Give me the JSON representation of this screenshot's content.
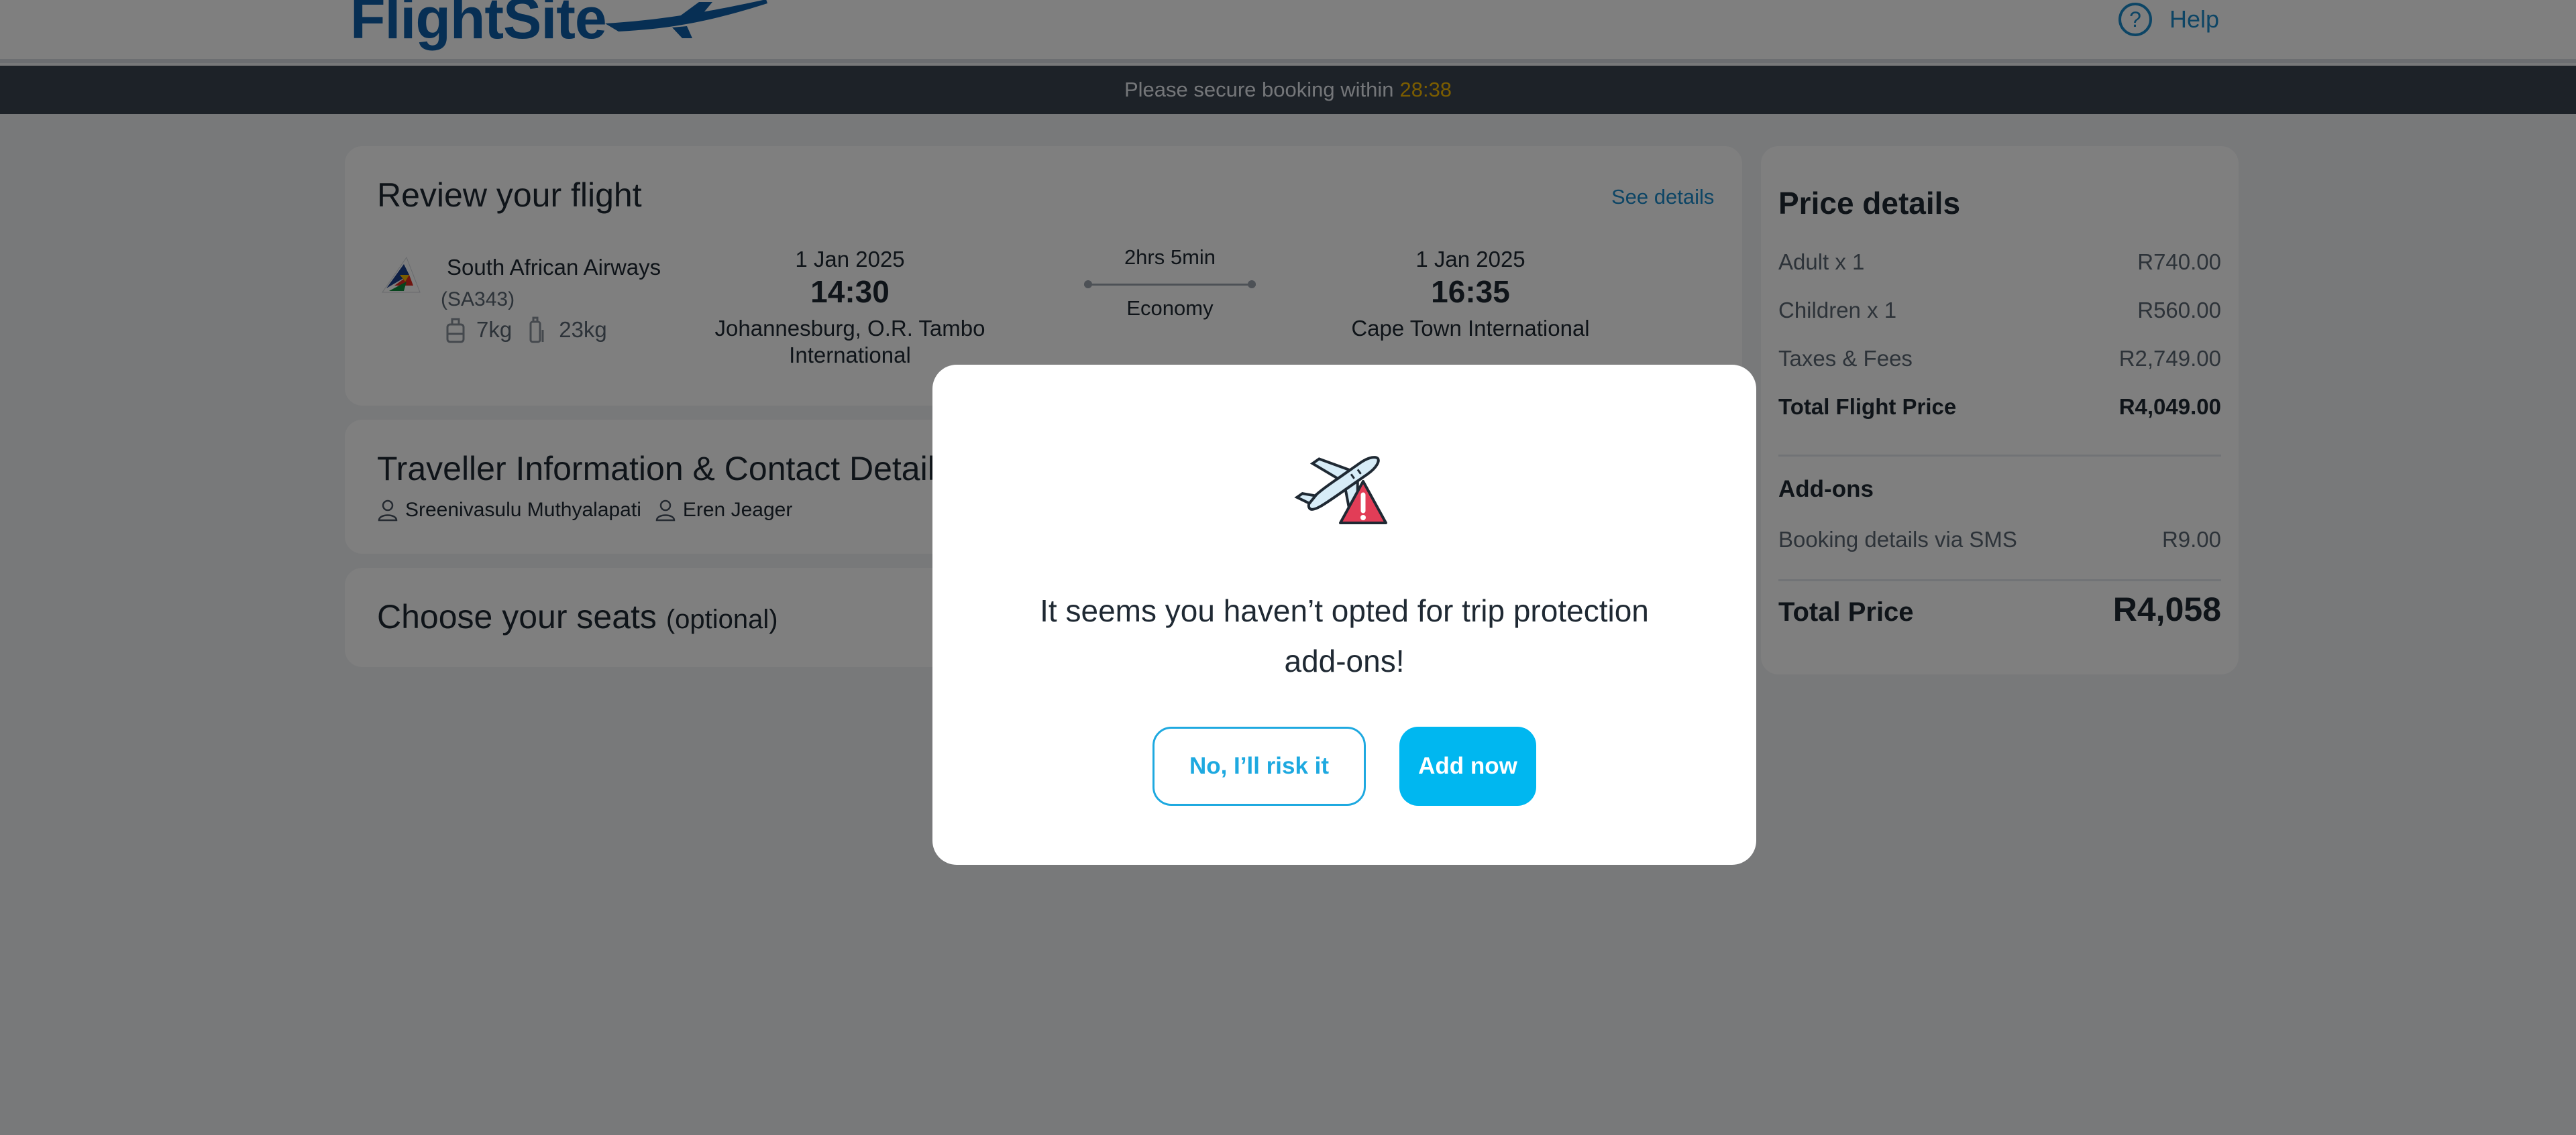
{
  "header": {
    "logo_text": "FlightSite",
    "help_label": "Help",
    "help_icon": "question-circle-icon"
  },
  "timer": {
    "message": "Please secure booking within",
    "time_left": "28:38",
    "accent_color": "#f5b800"
  },
  "review": {
    "title": "Review your flight",
    "see_details": "See details",
    "airline": "South African Airways",
    "flight_code": "(SA343)",
    "cabin_bag": "7kg",
    "checked_bag": "23kg",
    "departure": {
      "date": "1 Jan 2025",
      "time": "14:30",
      "airport": "Johannesburg, O.R. Tambo International"
    },
    "duration": "2hrs 5min",
    "cabin_class": "Economy",
    "arrival": {
      "date": "1 Jan 2025",
      "time": "16:35",
      "airport": "Cape Town International"
    }
  },
  "traveller": {
    "title": "Traveller Information & Contact Details",
    "passengers": [
      "Sreenivasulu Muthyalapati",
      "Eren Jeager"
    ]
  },
  "seats": {
    "title": "Choose your seats",
    "optional": "(optional)"
  },
  "price": {
    "title": "Price details",
    "rows": [
      {
        "label": "Adult x 1",
        "value": "R740.00"
      },
      {
        "label": "Children x 1",
        "value": "R560.00"
      },
      {
        "label": "Taxes & Fees",
        "value": "R2,749.00"
      }
    ],
    "total_flight_label": "Total Flight Price",
    "total_flight_value": "R4,049.00",
    "addons_title": "Add-ons",
    "addon_label": "Booking details via SMS",
    "addon_value": "R9.00",
    "total_label": "Total Price",
    "total_value": "R4,058"
  },
  "modal": {
    "icon": "plane-warning-icon",
    "message": "It seems you haven’t opted for trip protection add-ons!",
    "decline_label": "No, I’ll risk it",
    "add_label": "Add now",
    "accent_color": "#00b7f0"
  }
}
